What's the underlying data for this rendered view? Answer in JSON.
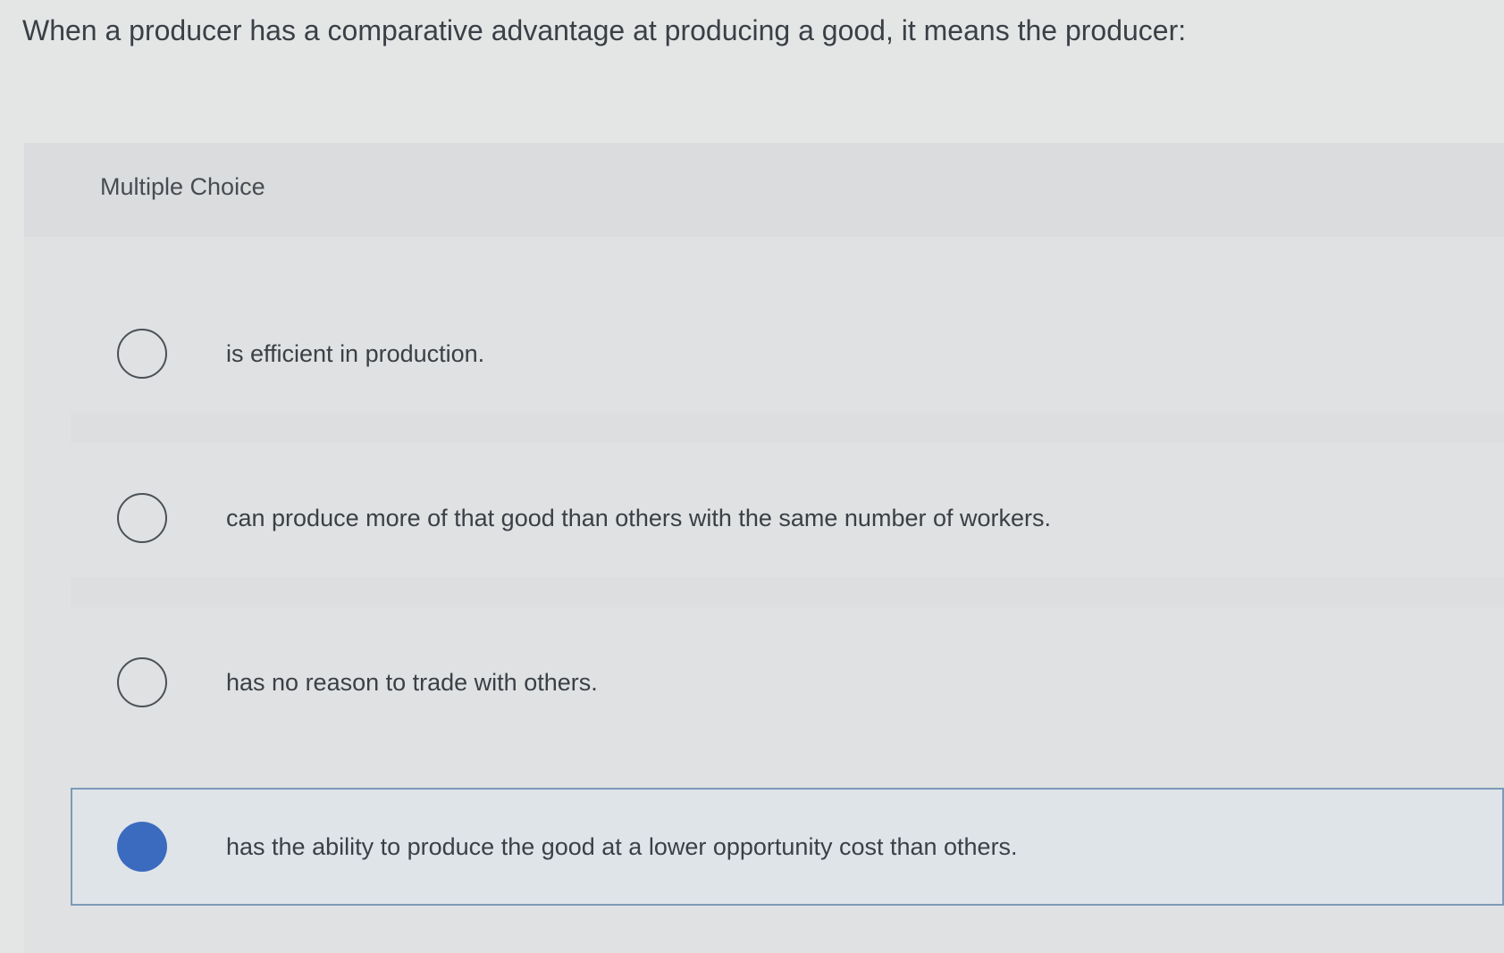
{
  "question": {
    "text": "When a producer has a comparative advantage at producing a good, it means the producer:"
  },
  "panel": {
    "label": "Multiple Choice"
  },
  "options": [
    {
      "text": "is efficient in production.",
      "selected": false
    },
    {
      "text": "can produce more of that good than others with the same number of workers.",
      "selected": false
    },
    {
      "text": "has no reason to trade with others.",
      "selected": false
    },
    {
      "text": "has the ability to produce the good at a lower opportunity cost than others.",
      "selected": true
    }
  ],
  "colors": {
    "selected_radio": "#3b6bbf",
    "selected_border": "#7d9ab8",
    "background": "#e4e6e6"
  }
}
